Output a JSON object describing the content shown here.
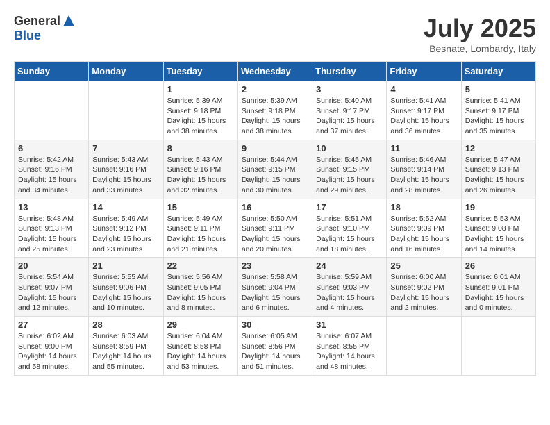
{
  "logo": {
    "general": "General",
    "blue": "Blue"
  },
  "title": {
    "month_year": "July 2025",
    "location": "Besnate, Lombardy, Italy"
  },
  "header_days": [
    "Sunday",
    "Monday",
    "Tuesday",
    "Wednesday",
    "Thursday",
    "Friday",
    "Saturday"
  ],
  "weeks": [
    {
      "days": [
        {
          "number": "",
          "info": ""
        },
        {
          "number": "",
          "info": ""
        },
        {
          "number": "1",
          "info": "Sunrise: 5:39 AM\nSunset: 9:18 PM\nDaylight: 15 hours\nand 38 minutes."
        },
        {
          "number": "2",
          "info": "Sunrise: 5:39 AM\nSunset: 9:18 PM\nDaylight: 15 hours\nand 38 minutes."
        },
        {
          "number": "3",
          "info": "Sunrise: 5:40 AM\nSunset: 9:17 PM\nDaylight: 15 hours\nand 37 minutes."
        },
        {
          "number": "4",
          "info": "Sunrise: 5:41 AM\nSunset: 9:17 PM\nDaylight: 15 hours\nand 36 minutes."
        },
        {
          "number": "5",
          "info": "Sunrise: 5:41 AM\nSunset: 9:17 PM\nDaylight: 15 hours\nand 35 minutes."
        }
      ]
    },
    {
      "days": [
        {
          "number": "6",
          "info": "Sunrise: 5:42 AM\nSunset: 9:16 PM\nDaylight: 15 hours\nand 34 minutes."
        },
        {
          "number": "7",
          "info": "Sunrise: 5:43 AM\nSunset: 9:16 PM\nDaylight: 15 hours\nand 33 minutes."
        },
        {
          "number": "8",
          "info": "Sunrise: 5:43 AM\nSunset: 9:16 PM\nDaylight: 15 hours\nand 32 minutes."
        },
        {
          "number": "9",
          "info": "Sunrise: 5:44 AM\nSunset: 9:15 PM\nDaylight: 15 hours\nand 30 minutes."
        },
        {
          "number": "10",
          "info": "Sunrise: 5:45 AM\nSunset: 9:15 PM\nDaylight: 15 hours\nand 29 minutes."
        },
        {
          "number": "11",
          "info": "Sunrise: 5:46 AM\nSunset: 9:14 PM\nDaylight: 15 hours\nand 28 minutes."
        },
        {
          "number": "12",
          "info": "Sunrise: 5:47 AM\nSunset: 9:13 PM\nDaylight: 15 hours\nand 26 minutes."
        }
      ]
    },
    {
      "days": [
        {
          "number": "13",
          "info": "Sunrise: 5:48 AM\nSunset: 9:13 PM\nDaylight: 15 hours\nand 25 minutes."
        },
        {
          "number": "14",
          "info": "Sunrise: 5:49 AM\nSunset: 9:12 PM\nDaylight: 15 hours\nand 23 minutes."
        },
        {
          "number": "15",
          "info": "Sunrise: 5:49 AM\nSunset: 9:11 PM\nDaylight: 15 hours\nand 21 minutes."
        },
        {
          "number": "16",
          "info": "Sunrise: 5:50 AM\nSunset: 9:11 PM\nDaylight: 15 hours\nand 20 minutes."
        },
        {
          "number": "17",
          "info": "Sunrise: 5:51 AM\nSunset: 9:10 PM\nDaylight: 15 hours\nand 18 minutes."
        },
        {
          "number": "18",
          "info": "Sunrise: 5:52 AM\nSunset: 9:09 PM\nDaylight: 15 hours\nand 16 minutes."
        },
        {
          "number": "19",
          "info": "Sunrise: 5:53 AM\nSunset: 9:08 PM\nDaylight: 15 hours\nand 14 minutes."
        }
      ]
    },
    {
      "days": [
        {
          "number": "20",
          "info": "Sunrise: 5:54 AM\nSunset: 9:07 PM\nDaylight: 15 hours\nand 12 minutes."
        },
        {
          "number": "21",
          "info": "Sunrise: 5:55 AM\nSunset: 9:06 PM\nDaylight: 15 hours\nand 10 minutes."
        },
        {
          "number": "22",
          "info": "Sunrise: 5:56 AM\nSunset: 9:05 PM\nDaylight: 15 hours\nand 8 minutes."
        },
        {
          "number": "23",
          "info": "Sunrise: 5:58 AM\nSunset: 9:04 PM\nDaylight: 15 hours\nand 6 minutes."
        },
        {
          "number": "24",
          "info": "Sunrise: 5:59 AM\nSunset: 9:03 PM\nDaylight: 15 hours\nand 4 minutes."
        },
        {
          "number": "25",
          "info": "Sunrise: 6:00 AM\nSunset: 9:02 PM\nDaylight: 15 hours\nand 2 minutes."
        },
        {
          "number": "26",
          "info": "Sunrise: 6:01 AM\nSunset: 9:01 PM\nDaylight: 15 hours\nand 0 minutes."
        }
      ]
    },
    {
      "days": [
        {
          "number": "27",
          "info": "Sunrise: 6:02 AM\nSunset: 9:00 PM\nDaylight: 14 hours\nand 58 minutes."
        },
        {
          "number": "28",
          "info": "Sunrise: 6:03 AM\nSunset: 8:59 PM\nDaylight: 14 hours\nand 55 minutes."
        },
        {
          "number": "29",
          "info": "Sunrise: 6:04 AM\nSunset: 8:58 PM\nDaylight: 14 hours\nand 53 minutes."
        },
        {
          "number": "30",
          "info": "Sunrise: 6:05 AM\nSunset: 8:56 PM\nDaylight: 14 hours\nand 51 minutes."
        },
        {
          "number": "31",
          "info": "Sunrise: 6:07 AM\nSunset: 8:55 PM\nDaylight: 14 hours\nand 48 minutes."
        },
        {
          "number": "",
          "info": ""
        },
        {
          "number": "",
          "info": ""
        }
      ]
    }
  ]
}
